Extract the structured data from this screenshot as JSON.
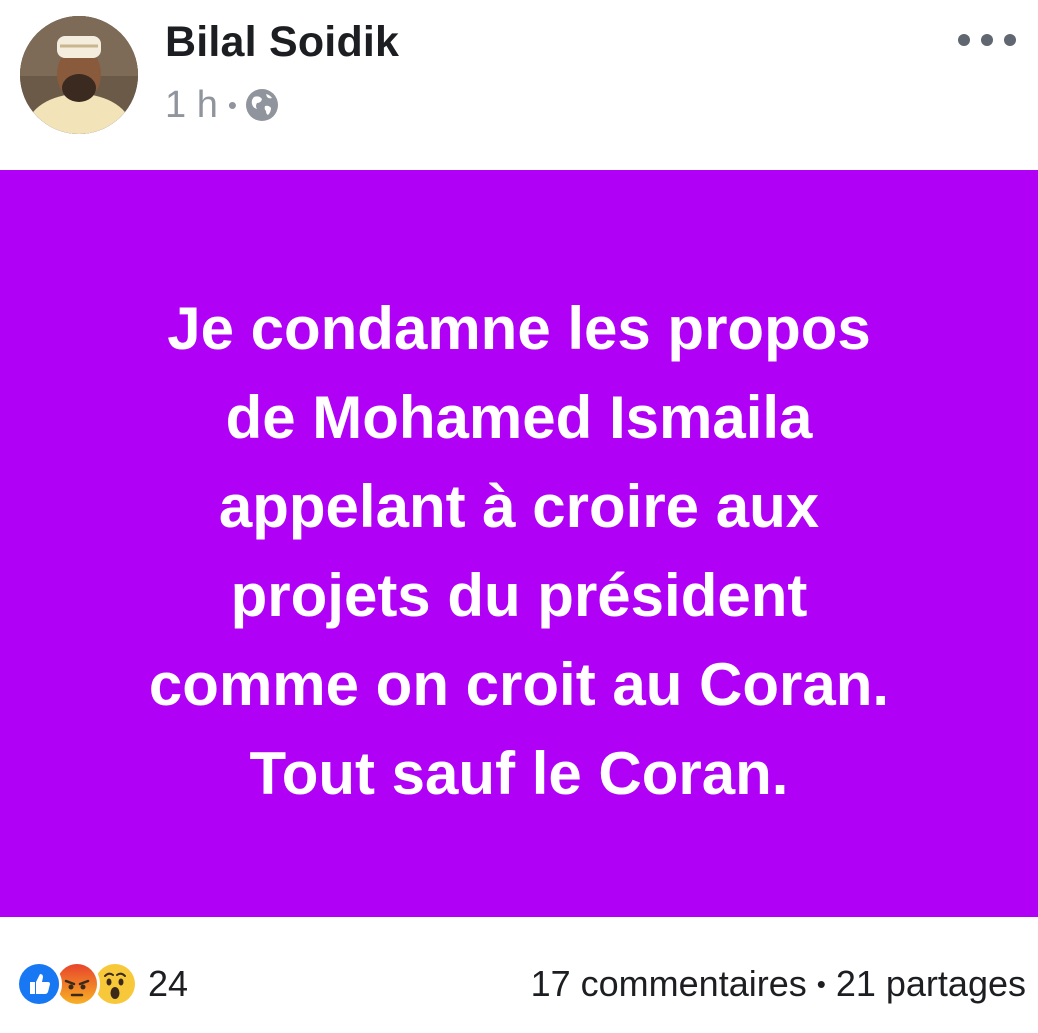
{
  "post": {
    "author_name": "Bilal Soidik",
    "timestamp": "1 h",
    "meta_separator": "•",
    "privacy_icon": "globe-icon",
    "more_icon": "more-horizontal-icon",
    "background_color": "#b000f5",
    "text_color": "#ffffff",
    "text_lines": [
      "Je condamne les propos",
      "de Mohamed Ismaila",
      "appelant à croire aux",
      "projets du président",
      "comme on croit au Coran.",
      "Tout sauf le Coran."
    ]
  },
  "footer": {
    "reaction_icons": [
      "like-icon",
      "angry-icon",
      "wow-icon"
    ],
    "reaction_count": "24",
    "comments_label": "17 commentaires",
    "separator": "•",
    "shares_label": "21 partages"
  }
}
